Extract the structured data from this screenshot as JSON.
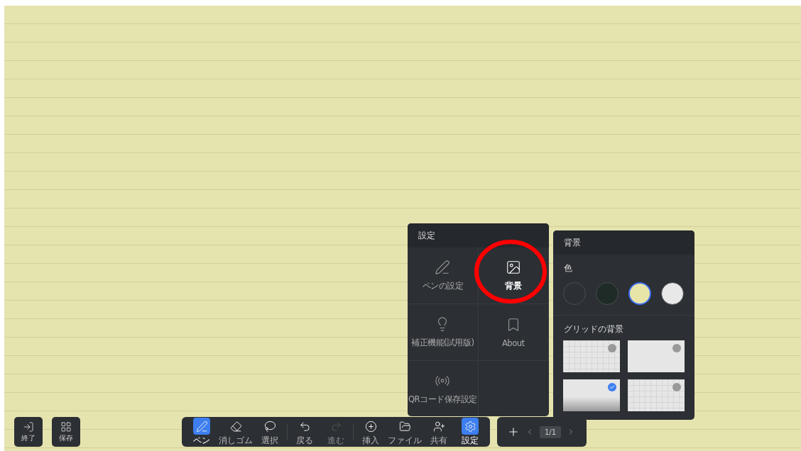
{
  "left_buttons": [
    {
      "kind": "exit",
      "label": "終了"
    },
    {
      "kind": "save",
      "label": "保存"
    }
  ],
  "settings_panel": {
    "title": "設定",
    "items": [
      {
        "kind": "pen",
        "label": "ペンの設定",
        "selected": false
      },
      {
        "kind": "background",
        "label": "背景",
        "selected": true
      },
      {
        "kind": "correction",
        "label": "補正機能(試用版)",
        "selected": false
      },
      {
        "kind": "about",
        "label": "About",
        "selected": false
      },
      {
        "kind": "qr",
        "label": "QRコード保存設定",
        "selected": false
      }
    ]
  },
  "background_panel": {
    "title": "背景",
    "color_label": "色",
    "colors": [
      {
        "color": "#2c2f33",
        "selected": false
      },
      {
        "color": "#1f2b26",
        "selected": false
      },
      {
        "color": "#e8e5a9",
        "selected": true
      },
      {
        "color": "#e8e8e8",
        "selected": false
      }
    ],
    "grid_label": "グリッドの背景",
    "grids": [
      {
        "kind": "grid",
        "selected": false
      },
      {
        "kind": "plain",
        "selected": false
      },
      {
        "kind": "fade",
        "selected": true
      },
      {
        "kind": "grid",
        "selected": false
      }
    ]
  },
  "toolbar": [
    {
      "kind": "pen",
      "label": "ペン",
      "selected": true,
      "disabled": false
    },
    {
      "kind": "eraser",
      "label": "消しゴム",
      "selected": false,
      "disabled": false
    },
    {
      "kind": "lasso",
      "label": "選択",
      "selected": false,
      "disabled": false
    },
    {
      "kind": "divider"
    },
    {
      "kind": "undo",
      "label": "戻る",
      "selected": false,
      "disabled": false
    },
    {
      "kind": "redo",
      "label": "進む",
      "selected": false,
      "disabled": true
    },
    {
      "kind": "divider"
    },
    {
      "kind": "insert",
      "label": "挿入",
      "selected": false,
      "disabled": false
    },
    {
      "kind": "file",
      "label": "ファイル",
      "selected": false,
      "disabled": false
    },
    {
      "kind": "share",
      "label": "共有",
      "selected": false,
      "disabled": false
    },
    {
      "kind": "settings",
      "label": "設定",
      "selected": true,
      "disabled": false
    }
  ],
  "pager": {
    "page": "1/1"
  }
}
